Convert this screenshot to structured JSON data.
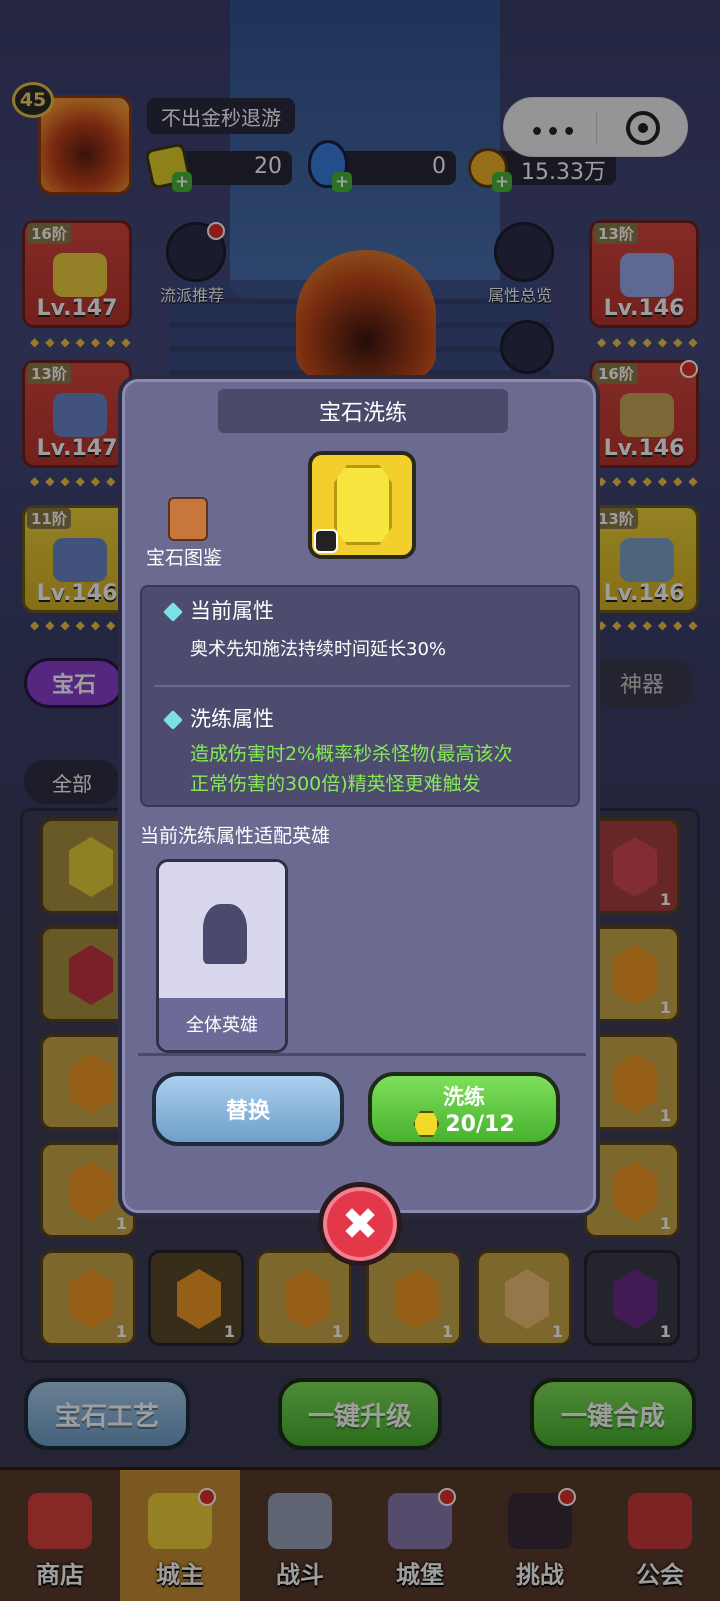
{
  "player": {
    "level": "45",
    "name": "不出金秒退游"
  },
  "resources": {
    "gems": "20",
    "potion": "0",
    "gold": "15.33万"
  },
  "side": {
    "left": [
      {
        "tier": "16阶",
        "level": "Lv.147"
      },
      {
        "tier": "13阶",
        "level": "Lv.147"
      },
      {
        "tier": "11阶",
        "level": "Lv.146"
      }
    ],
    "right": [
      {
        "tier": "13阶",
        "level": "Lv.146"
      },
      {
        "tier": "16阶",
        "level": "Lv.146"
      },
      {
        "tier": "13阶",
        "level": "Lv.146"
      }
    ],
    "recommend_label": "流派推荐",
    "attributes_label": "属性总览"
  },
  "tabs": {
    "gem": "宝石",
    "artifact": "神器",
    "filter_all": "全部"
  },
  "modal": {
    "title": "宝石洗练",
    "catalog_label": "宝石图鉴",
    "current_header": "当前属性",
    "current_text": "奥术先知施法持续时间延长30%",
    "refine_header": "洗练属性",
    "refine_text_1": "造成伤害时2%概率秒杀怪物(最高该次",
    "refine_text_2": "正常伤害的300倍)精英怪更难触发",
    "heroes_header": "当前洗练属性适配英雄",
    "hero_label": "全体英雄",
    "replace_button": "替换",
    "refine_button": "洗练",
    "refine_cost": "20/12"
  },
  "grid_counts": [
    "1",
    "1",
    "1",
    "1",
    "1",
    "1",
    "1",
    "1",
    "1",
    "1",
    "1"
  ],
  "actions": {
    "craft": "宝石工艺",
    "upgrade": "一键升级",
    "merge": "一键合成"
  },
  "nav": [
    {
      "label": "商店",
      "icon": "shop-icon"
    },
    {
      "label": "城主",
      "icon": "crown-icon"
    },
    {
      "label": "战斗",
      "icon": "swords-icon"
    },
    {
      "label": "城堡",
      "icon": "castle-icon"
    },
    {
      "label": "挑战",
      "icon": "demon-icon"
    },
    {
      "label": "公会",
      "icon": "banner-icon"
    }
  ],
  "colors": {
    "accent_green": "#86ea58",
    "modal_bg": "#6b6a91",
    "close_red": "#e2384a"
  }
}
